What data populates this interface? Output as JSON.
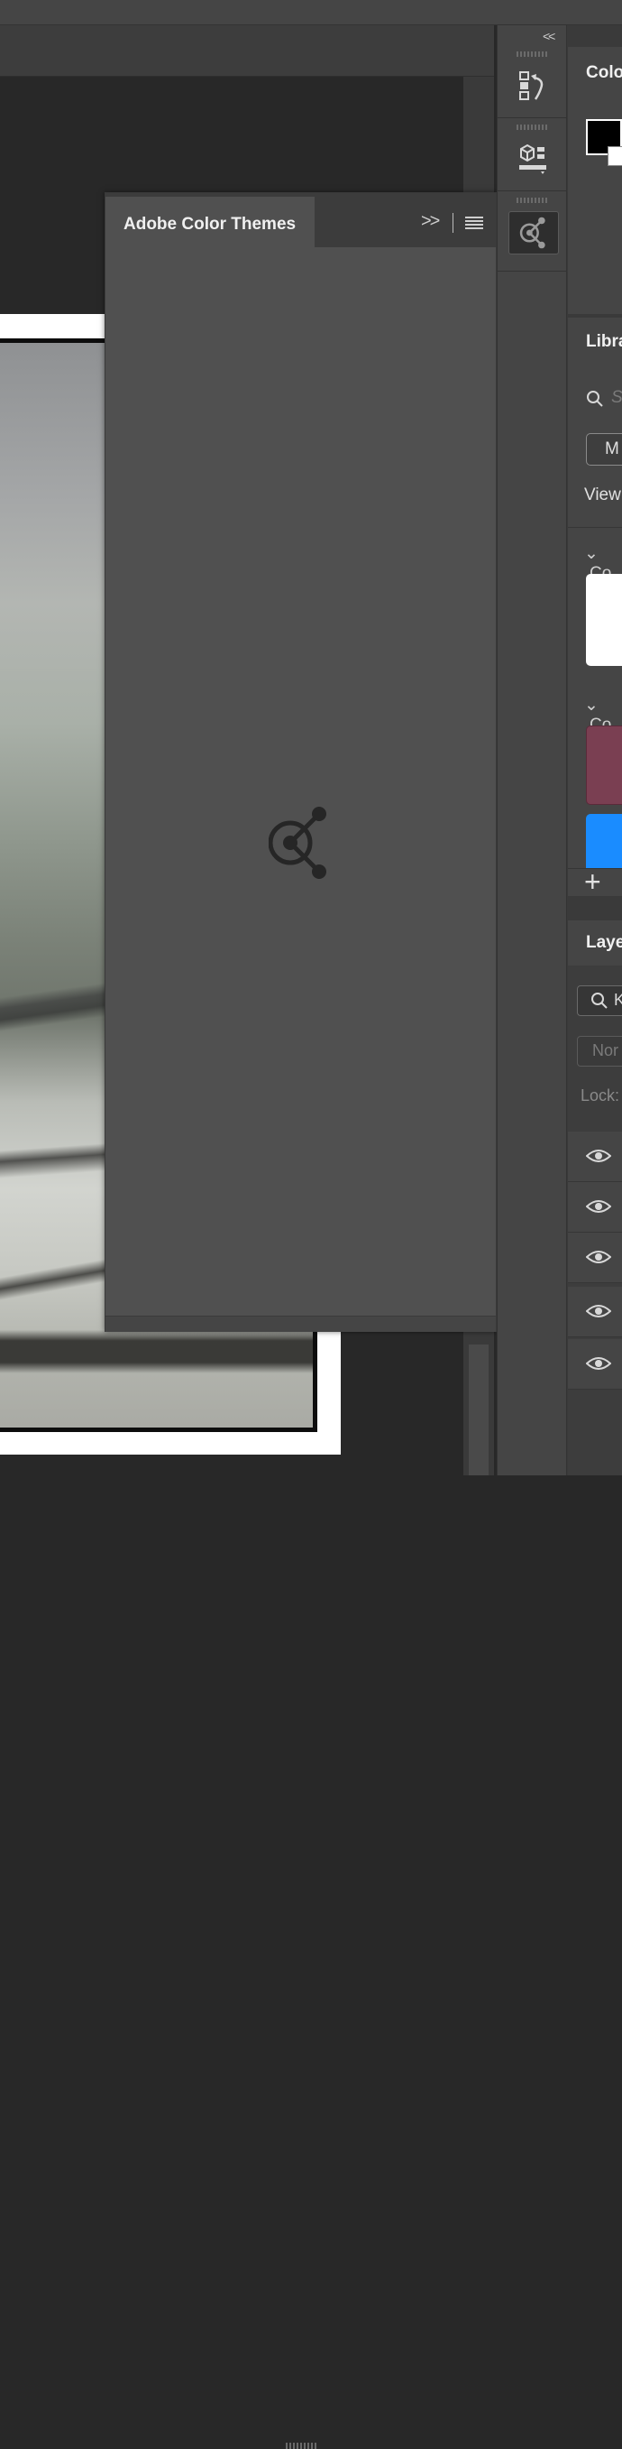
{
  "panel": {
    "title": "Adobe Color Themes",
    "collapse_label": ">>"
  },
  "dock": {
    "collapse_label": "<<"
  },
  "right_panels": {
    "color_title": "Colo",
    "libraries_title": "Libra",
    "libraries_search_placeholder": "S",
    "libraries_dropdown": "M",
    "libraries_view_label": "View",
    "section_1_label": "Co",
    "section_2_label": "Co",
    "swatch_colors": [
      "#ffffff",
      "#7a3f52",
      "#1a8cff"
    ],
    "layers_title": "Laye",
    "layers_search": "K",
    "blend_mode": "Nor",
    "lock_label": "Lock:",
    "layer_count": 5
  },
  "icons": {
    "dock": [
      "history-icon",
      "3d-icon",
      "adobe-color-themes-icon"
    ],
    "panel_center": "adobe-color-themes-icon"
  }
}
